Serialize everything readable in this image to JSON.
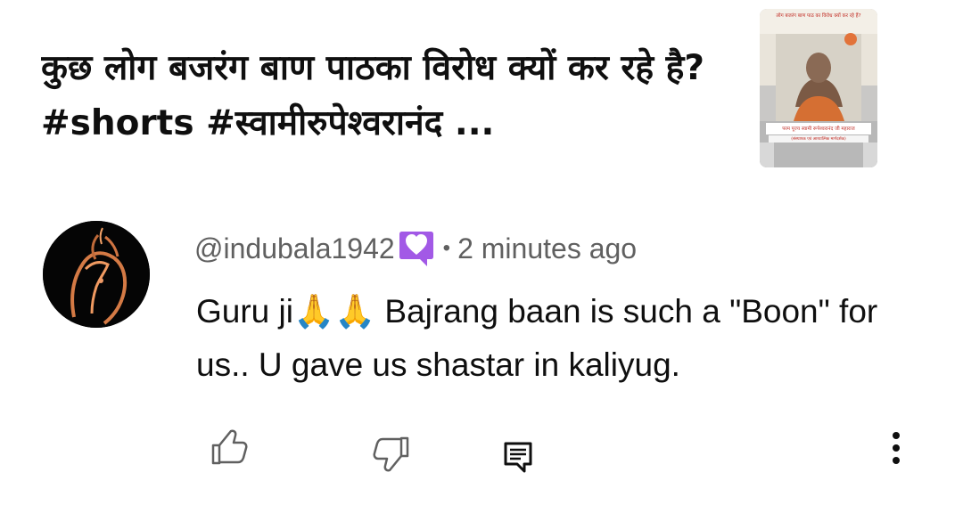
{
  "video": {
    "title": "कुछ लोग बजरंग बाण पाठका विरोध क्यों कर रहे है? #shorts  #स्वामीरुपेश्वरानंद ...",
    "thumbnail_title": "लोग बजरंग बाण पाठ का विरोध क्यों कर रहे हैं?",
    "thumbnail_caption": "परम पूज्य स्वामी रूपेश्वरानंद जी महाराज",
    "thumbnail_subcaption": "(संस्थापक एवं आध्यात्मिक मार्गदर्शक)"
  },
  "comment": {
    "author": "@indubala1942",
    "separator": "•",
    "timestamp": "2 minutes ago",
    "text": "Guru ji🙏🙏 Bajrang baan is such a \"Boon\" for us.. U gave us shastar in kaliyug.",
    "badge_icon": "heart-badge-icon",
    "badge_color": "#a259e6"
  },
  "actions": {
    "like_icon": "thumbs-up-icon",
    "dislike_icon": "thumbs-down-icon",
    "reply_icon": "reply-comment-icon",
    "more_icon": "more-vertical-icon"
  },
  "colors": {
    "text_primary": "#0f0f0f",
    "text_secondary": "#606060",
    "thumbnail_text_red": "#c0271f"
  }
}
